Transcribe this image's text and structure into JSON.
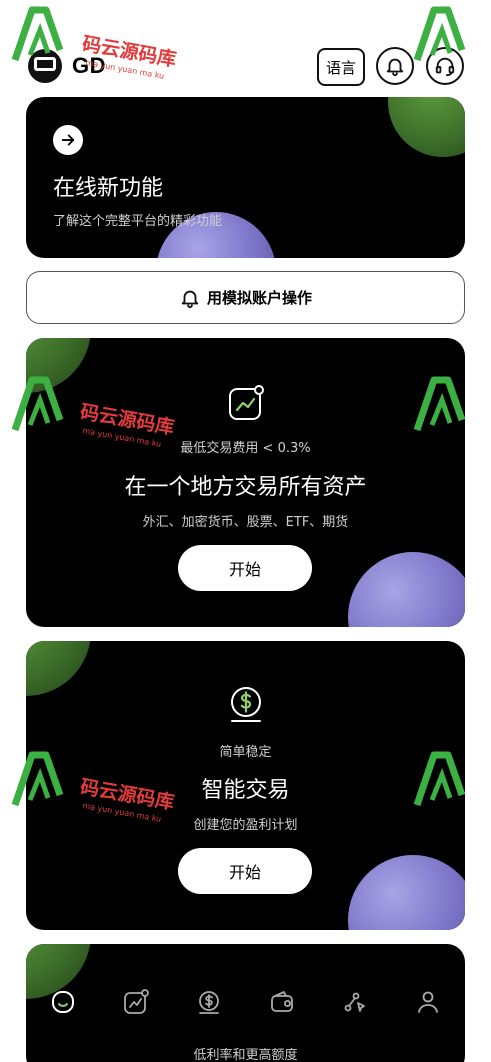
{
  "header": {
    "logo_text": "GD",
    "language_label": "语言",
    "icons": [
      "logo-icon",
      "bell-icon",
      "support-headset-icon"
    ]
  },
  "promo_card": {
    "title": "在线新功能",
    "subtitle": "了解这个完整平台的精彩功能",
    "icon": "arrow-right-icon"
  },
  "demo_button": {
    "label": "用模拟账户操作",
    "icon": "bell-icon"
  },
  "features": [
    {
      "icon": "trend-chart-icon",
      "small": "最低交易费用 < 0.3%",
      "title": "在一个地方交易所有资产",
      "desc": "外汇、加密货币、股票、ETF、期货",
      "button": "开始"
    },
    {
      "icon": "dollar-coin-icon",
      "small": "简单稳定",
      "title": "智能交易",
      "desc": "创建您的盈利计划",
      "button": "开始"
    }
  ],
  "bottom_card": {
    "text": "低利率和更高额度"
  },
  "bottom_nav": [
    "home-icon",
    "chart-icon",
    "dollar-icon",
    "wallet-icon",
    "route-icon",
    "user-icon"
  ],
  "watermark": {
    "title": "码云源码库",
    "sub": "ma yun yuan ma ku"
  },
  "colors": {
    "card_bg": "#000000",
    "green_blob": "#4a7d32",
    "purple_blob": "#7b74c7",
    "trend_green": "#8fd16a",
    "watermark": "#e23b3b"
  }
}
